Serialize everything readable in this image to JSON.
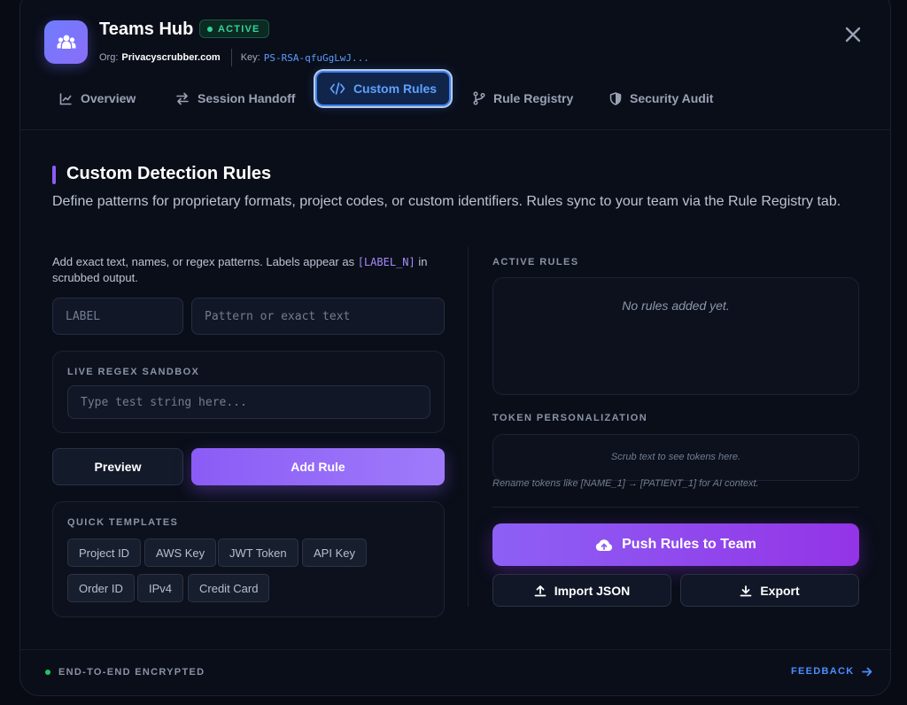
{
  "header": {
    "title": "Teams Hub",
    "status_badge": "ACTIVE",
    "org_label": "Org:",
    "org_value": "Privacyscrubber.com",
    "key_label": "Key:",
    "key_value": "PS-RSA-qfuGgLwJ...",
    "icon": "users-icon",
    "close_icon": "close-icon"
  },
  "tabs": [
    {
      "label": "Overview",
      "icon": "chart-line-icon",
      "active": false
    },
    {
      "label": "Session Handoff",
      "icon": "swap-arrows-icon",
      "active": false
    },
    {
      "label": "Custom Rules",
      "icon": "code-icon",
      "active": true
    },
    {
      "label": "Rule Registry",
      "icon": "git-branch-icon",
      "active": false
    },
    {
      "label": "Security Audit",
      "icon": "shield-icon",
      "active": false
    }
  ],
  "section": {
    "title": "Custom Detection Rules",
    "description": "Define patterns for proprietary formats, project codes, or custom identifiers. Rules sync to your team via the Rule Registry tab."
  },
  "rule_form": {
    "help_text_before": "Add exact text, names, or regex patterns. Labels appear as",
    "help_token": "[LABEL_N]",
    "help_text_after": "in scrubbed output.",
    "label_placeholder": "LABEL",
    "pattern_placeholder": "Pattern or exact text"
  },
  "sandbox": {
    "title": "LIVE REGEX SANDBOX",
    "placeholder": "Type test string here..."
  },
  "actions": {
    "preview_label": "Preview",
    "add_rule_label": "Add Rule"
  },
  "templates": {
    "title": "QUICK TEMPLATES",
    "items": [
      "Project ID",
      "AWS Key",
      "JWT Token",
      "API Key",
      "Order ID",
      "IPv4",
      "Credit Card"
    ]
  },
  "active_rules": {
    "title": "ACTIVE RULES",
    "empty_text": "No rules added yet."
  },
  "token_personalization": {
    "title": "TOKEN PERSONALIZATION",
    "empty_text": "Scrub text to see tokens here.",
    "note": "Rename tokens like [NAME_1] → [PATIENT_1] for AI context."
  },
  "push": {
    "label": "Push Rules to Team",
    "icon": "cloud-upload-icon"
  },
  "import_label": "Import JSON",
  "export_label": "Export",
  "footer": {
    "encrypted_label": "END-TO-END ENCRYPTED",
    "feedback_label": "FEEDBACK"
  },
  "colors": {
    "accent_purple": "#8b5cf6",
    "accent_blue": "#3b82f6",
    "status_green": "#34d399",
    "background": "#0a0e19"
  }
}
